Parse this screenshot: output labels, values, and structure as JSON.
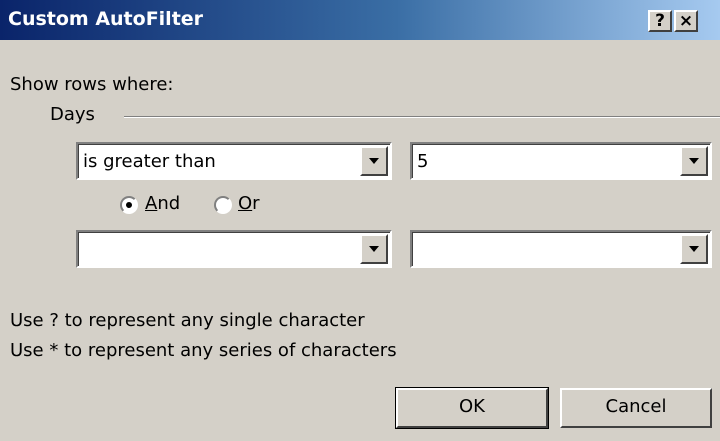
{
  "window": {
    "title": "Custom AutoFilter",
    "help_label": "?",
    "close_label": "×"
  },
  "prompt": "Show rows where:",
  "group": {
    "label": "Days"
  },
  "criteria1": {
    "operator": "is greater than",
    "value": "5"
  },
  "logic": {
    "and_label": "And",
    "and_label_rest": "nd",
    "and_accel": "A",
    "or_label": "Or",
    "or_accel": "O",
    "or_label_rest": "r",
    "selected": "And"
  },
  "criteria2": {
    "operator": "",
    "value": ""
  },
  "hints": {
    "line1": "Use ? to represent any single character",
    "line2": "Use * to represent any series of characters"
  },
  "buttons": {
    "ok": "OK",
    "cancel": "Cancel"
  }
}
